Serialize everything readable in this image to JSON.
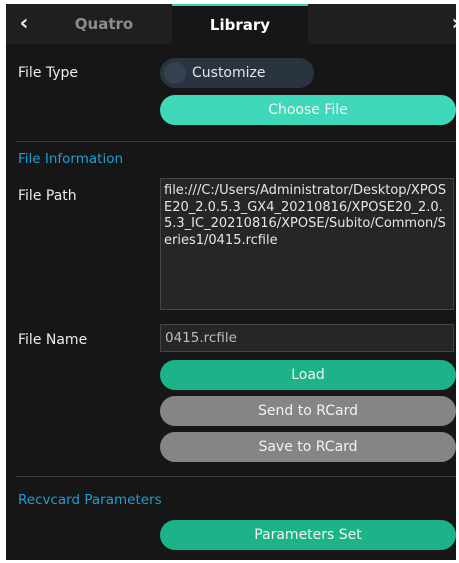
{
  "tabs": {
    "back_arrow": "‹",
    "forward_arrow": "›",
    "items": [
      {
        "label": "Quatro",
        "active": false
      },
      {
        "label": "Library",
        "active": true
      }
    ]
  },
  "file_type": {
    "label": "File Type",
    "selected": "Customize",
    "choose_button": "Choose File"
  },
  "file_information": {
    "section_title": "File Information",
    "path_label": "File Path",
    "path_value": "file:///C:/Users/Administrator/Desktop/XPOSE20_2.0.5.3_GX4_20210816/XPOSE20_2.0.5.3_IC_20210816/XPOSE/Subito/Common/Series1/0415.rcfile",
    "name_label": "File Name",
    "name_value": "0415.rcfile",
    "load_button": "Load",
    "send_button": "Send to RCard",
    "save_button": "Save to RCard"
  },
  "recvcard": {
    "section_title": "Recvcard Parameters",
    "parameters_button": "Parameters Set"
  },
  "colors": {
    "accent_cyan": "#3fd8b8",
    "accent_teal": "#1cb389",
    "disabled_gray": "#858585",
    "section_blue": "#1f9fd0",
    "background": "#161616"
  }
}
